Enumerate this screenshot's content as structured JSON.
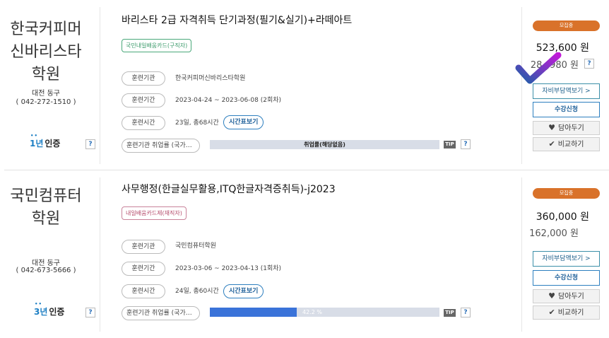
{
  "courses": [
    {
      "institute": {
        "name_lines": [
          "한국커피머",
          "신바리스타",
          "학원"
        ],
        "area": "대전 동구",
        "phone": "( 042-272-1510 )",
        "cert": {
          "years": "1년",
          "label": "인증"
        }
      },
      "title": "바리스타 2급 자격취득 단기과정(필기&실기)+라떼아트",
      "tag": "국민내일배움카드(구직자)",
      "rows": [
        {
          "label": "훈련기관",
          "value": "한국커피머신바리스타학원"
        },
        {
          "label": "훈련기간",
          "value": "2023-04-24 ~ 2023-06-08 (2회차)"
        },
        {
          "label": "훈련시간",
          "value": "23일, 총68시간",
          "button": "시간표보기"
        }
      ],
      "employment": {
        "label": "훈련기관 취업률 (국가…",
        "bar_text": "취업률(해당없음)",
        "rate": 0
      },
      "status": "모집중",
      "price": "523,600 원",
      "self_pay": "28_,980 원",
      "buttons": {
        "self_pay": "자비부담액보기 >",
        "apply": "수강신청",
        "wish": "담아두기",
        "compare": "비교하기"
      }
    },
    {
      "institute": {
        "name_lines": [
          "국민컴퓨터",
          "학원"
        ],
        "area": "대전 동구",
        "phone": "( 042-673-5666 )",
        "cert": {
          "years": "3년",
          "label": "인증"
        }
      },
      "title": "사무행정(한글실무활용,ITQ한글자격증취득)-j2023",
      "tag": "내일배움카드제(재직자)",
      "rows": [
        {
          "label": "훈련기관",
          "value": "국민컴퓨터학원"
        },
        {
          "label": "훈련기간",
          "value": "2023-03-06 ~ 2023-04-13 (1회차)"
        },
        {
          "label": "훈련시간",
          "value": "24일, 총60시간",
          "button": "시간표보기"
        }
      ],
      "employment": {
        "label": "훈련기관 취업률 (국가…",
        "bar_text": "42.2 %",
        "rate": 42.2
      },
      "status": "모집중",
      "price": "360,000 원",
      "self_pay": "162,000 원",
      "buttons": {
        "self_pay": "자비부담액보기 >",
        "apply": "수강신청",
        "wish": "담아두기",
        "compare": "비교하기"
      }
    }
  ],
  "common": {
    "tip": "TIP",
    "help": "?"
  },
  "colors": {
    "status_badge": "#d9722a",
    "bar_fill": "#3a73d9",
    "bar_bg": "#d8dde7",
    "cursor_check": "#8a2be2"
  }
}
